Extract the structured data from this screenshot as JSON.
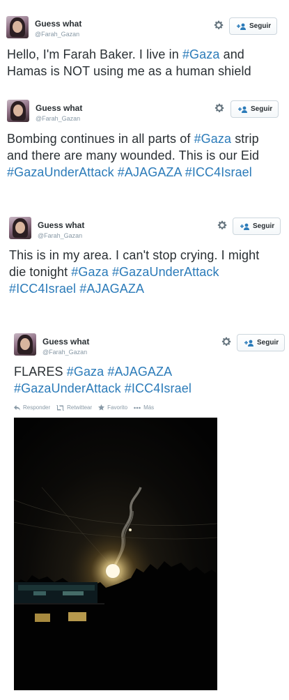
{
  "account": {
    "name": "Guess what",
    "handle": "@Farah_Gazan",
    "follow_label": "Seguir"
  },
  "tweets": [
    {
      "segments": [
        {
          "text": "Hello, I'm Farah Baker. I live in ",
          "tag": false
        },
        {
          "text": "#Gaza",
          "tag": true
        },
        {
          "text": " and Hamas is NOT using me as a human shield",
          "tag": false
        }
      ]
    },
    {
      "segments": [
        {
          "text": "Bombing continues in all parts of ",
          "tag": false
        },
        {
          "text": "#Gaza",
          "tag": true
        },
        {
          "text": " strip and there are many wounded. This is our Eid ",
          "tag": false
        },
        {
          "text": "#GazaUnderAttack",
          "tag": true
        },
        {
          "text": " ",
          "tag": false
        },
        {
          "text": "#AJAGAZA",
          "tag": true
        },
        {
          "text": " ",
          "tag": false
        },
        {
          "text": "#ICC4Israel",
          "tag": true
        }
      ]
    },
    {
      "segments": [
        {
          "text": "This is in my area. I can't stop crying. I might die tonight ",
          "tag": false
        },
        {
          "text": "#Gaza",
          "tag": true
        },
        {
          "text": " ",
          "tag": false
        },
        {
          "text": "#GazaUnderAttack",
          "tag": true
        },
        {
          "text": " ",
          "tag": false
        },
        {
          "text": "#ICC4Israel",
          "tag": true
        },
        {
          "text": " ",
          "tag": false
        },
        {
          "text": "#AJAGAZA",
          "tag": true
        }
      ]
    },
    {
      "segments": [
        {
          "text": "FLARES ",
          "tag": false
        },
        {
          "text": "#Gaza",
          "tag": true
        },
        {
          "text": " ",
          "tag": false
        },
        {
          "text": "#AJAGAZA",
          "tag": true
        },
        {
          "text": " ",
          "tag": false
        },
        {
          "text": "#GazaUnderAttack",
          "tag": true
        },
        {
          "text": " ",
          "tag": false
        },
        {
          "text": "#ICC4Israel",
          "tag": true
        }
      ]
    }
  ],
  "actions": {
    "reply": "Responder",
    "retweet": "Retwittear",
    "favorite": "Favorito",
    "more": "Más"
  },
  "colors": {
    "hashtag": "#2b7bb9",
    "text": "#292f33",
    "muted": "#8899a6",
    "follow_icon": "#2b7bb9"
  },
  "icons": {
    "settings": "gear-icon",
    "follow": "add-person-icon",
    "reply": "reply-icon",
    "retweet": "retweet-icon",
    "favorite": "star-icon",
    "more": "more-icon"
  }
}
